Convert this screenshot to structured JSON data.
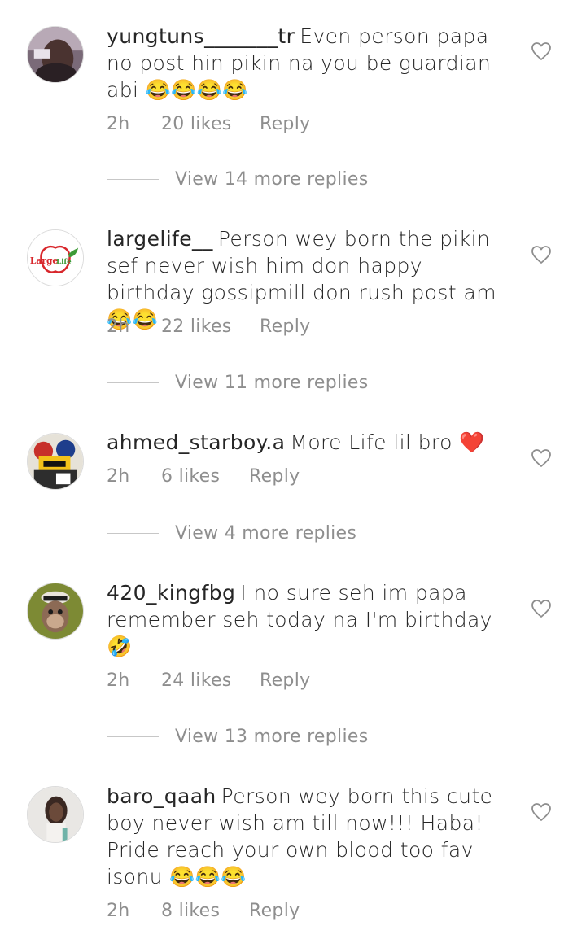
{
  "comments": [
    {
      "username": "yungtuns_______tr",
      "text": "Even person papa no post hin pikin na you be guardian abi 😂😂😂😂",
      "time": "2h",
      "likes": "20 likes",
      "reply_label": "Reply",
      "view_replies": "View 14 more replies"
    },
    {
      "username": "largelife__",
      "text": "Person wey born the pikin sef never wish him don happy birthday gossipmill don rush post am😂😂",
      "time": "2h",
      "likes": "22 likes",
      "reply_label": "Reply",
      "view_replies": "View 11 more replies",
      "avatar_text_1": "Large",
      "avatar_text_2": "Life"
    },
    {
      "username": "ahmed_starboy.a",
      "text": "More Life lil bro ❤️",
      "time": "2h",
      "likes": "6 likes",
      "reply_label": "Reply",
      "view_replies": "View 4 more replies"
    },
    {
      "username": "420_kingfbg",
      "text": "I no sure seh im papa remember seh today na I'm birthday 🤣",
      "time": "2h",
      "likes": "24 likes",
      "reply_label": "Reply",
      "view_replies": "View 13 more replies"
    },
    {
      "username": "baro_qaah",
      "text": "Person wey born this cute boy never wish am till now!!! Haba! Pride reach your own blood too fav isonu 😂😂😂",
      "time": "2h",
      "likes": "8 likes",
      "reply_label": "Reply"
    }
  ],
  "icons": {
    "like": "heart-outline-icon"
  },
  "colors": {
    "text": "#262626",
    "secondary": "#8e8e8e",
    "divider": "#c7c7c7"
  }
}
